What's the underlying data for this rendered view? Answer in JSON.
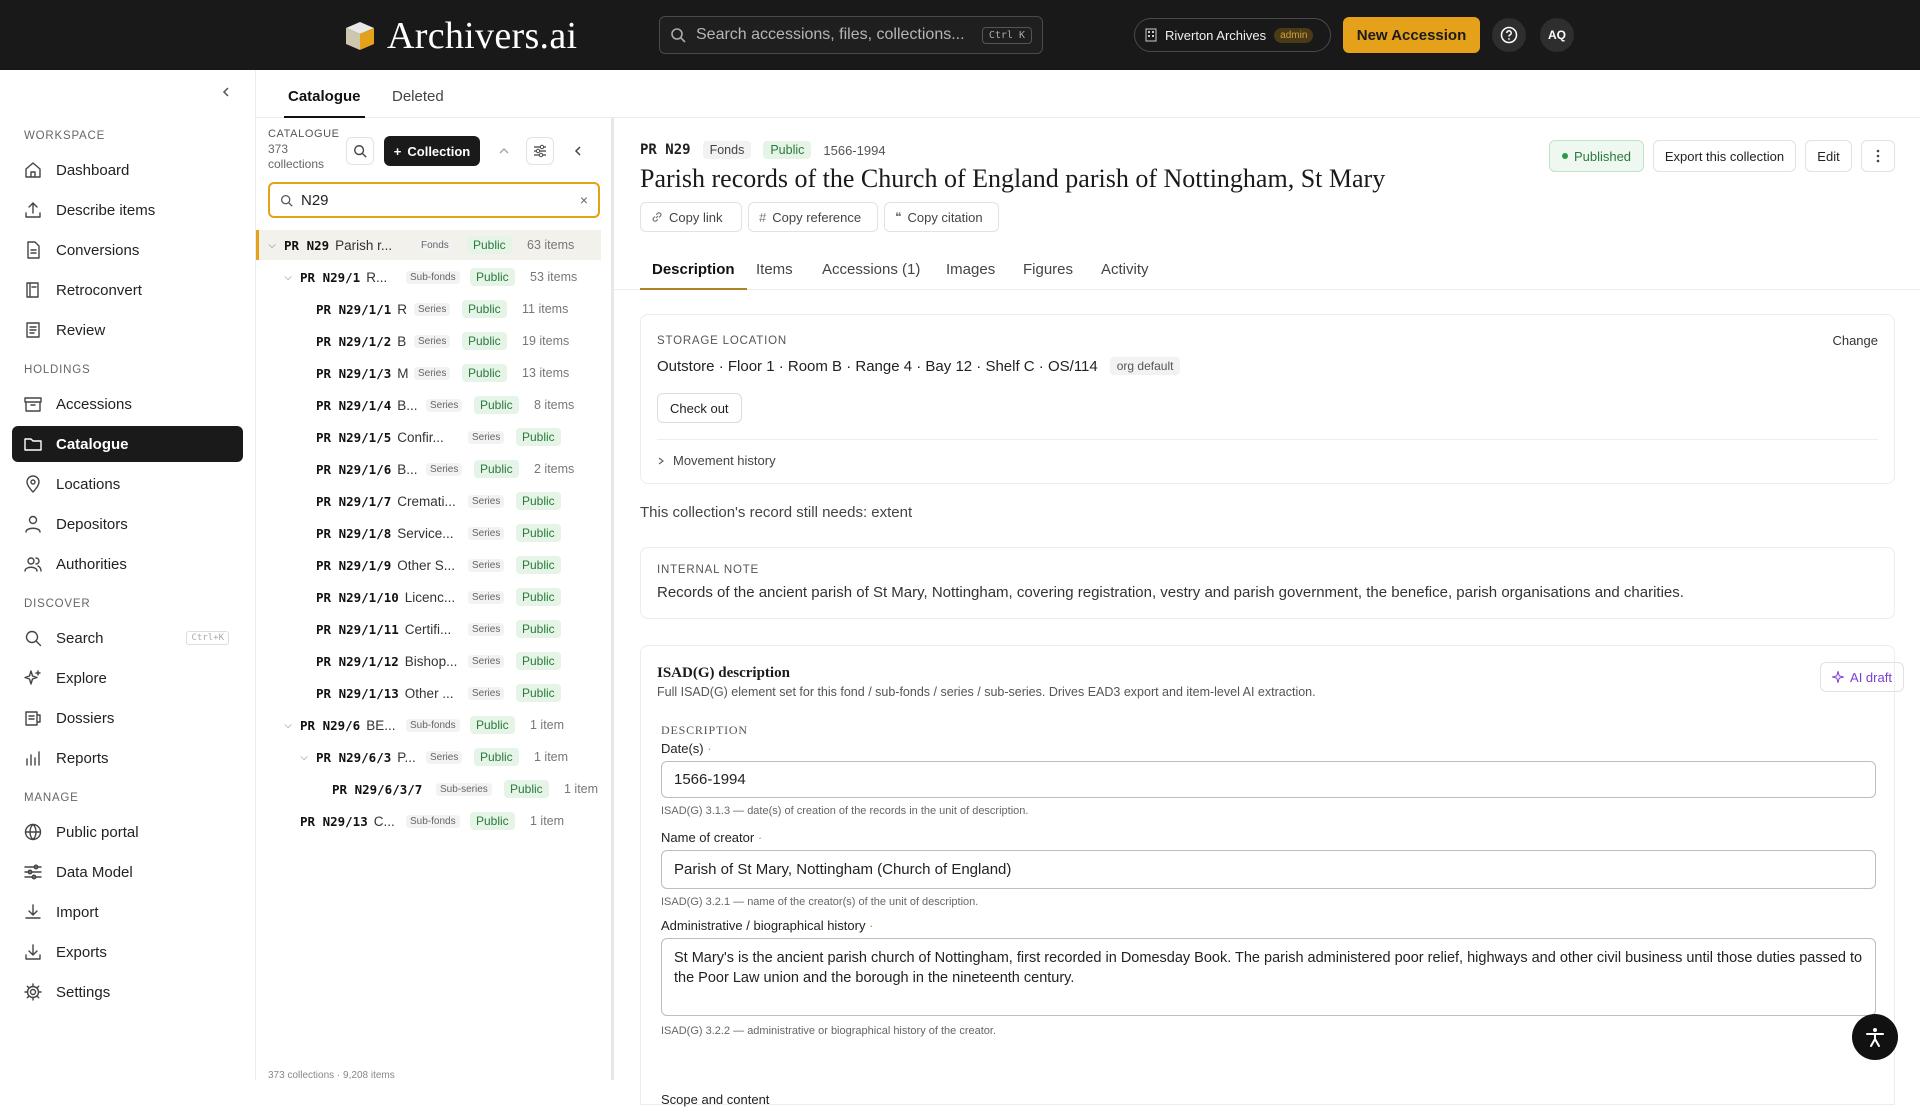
{
  "app": {
    "name": "Archivers.ai"
  },
  "topbar": {
    "search_placeholder": "Search accessions, files, collections...",
    "search_shortcut": "Ctrl K",
    "org_name": "Riverton Archives",
    "org_role": "admin",
    "new_button": "New Accession",
    "avatar": "AQ"
  },
  "sidebar": {
    "sections": [
      {
        "title": "WORKSPACE",
        "items": [
          {
            "label": "Dashboard",
            "icon": "home-icon"
          },
          {
            "label": "Describe items",
            "icon": "upload-icon"
          },
          {
            "label": "Conversions",
            "icon": "file-icon"
          },
          {
            "label": "Retroconvert",
            "icon": "book-icon"
          },
          {
            "label": "Review",
            "icon": "review-icon"
          }
        ]
      },
      {
        "title": "HOLDINGS",
        "items": [
          {
            "label": "Accessions",
            "icon": "archive-icon"
          },
          {
            "label": "Catalogue",
            "icon": "folder-icon",
            "active": true
          },
          {
            "label": "Locations",
            "icon": "pin-icon"
          },
          {
            "label": "Depositors",
            "icon": "user-icon"
          },
          {
            "label": "Authorities",
            "icon": "users-icon"
          }
        ]
      },
      {
        "title": "DISCOVER",
        "items": [
          {
            "label": "Search",
            "icon": "search-icon",
            "shortcut": "Ctrl+K"
          },
          {
            "label": "Explore",
            "icon": "sparkle-icon"
          },
          {
            "label": "Dossiers",
            "icon": "dossier-icon"
          },
          {
            "label": "Reports",
            "icon": "chart-icon"
          }
        ]
      },
      {
        "title": "MANAGE",
        "items": [
          {
            "label": "Public portal",
            "icon": "globe-icon"
          },
          {
            "label": "Data Model",
            "icon": "sliders-icon"
          },
          {
            "label": "Import",
            "icon": "download-icon"
          },
          {
            "label": "Exports",
            "icon": "export-icon"
          },
          {
            "label": "Settings",
            "icon": "gear-icon"
          }
        ]
      }
    ]
  },
  "tabs": {
    "catalogue": "Catalogue",
    "deleted": "Deleted"
  },
  "tree": {
    "heading": "CATALOGUE",
    "count": "373",
    "count_label": "collections",
    "add_button": "Collection",
    "filter_value": "N29",
    "footer": "373 collections · 9,208 items",
    "rows": [
      {
        "ref": "PR N29",
        "name": "Parish r...",
        "level": "Fonds",
        "status": "Public",
        "count": "63 items",
        "depth": 0,
        "expanded": true,
        "selected": true
      },
      {
        "ref": "PR N29/1",
        "name": "R...",
        "level": "Sub-fonds",
        "status": "Public",
        "count": "53 items",
        "depth": 1,
        "expanded": true
      },
      {
        "ref": "PR N29/1/1",
        "name": "R",
        "level": "Series",
        "status": "Public",
        "count": "11 items",
        "depth": 2
      },
      {
        "ref": "PR N29/1/2",
        "name": "B",
        "level": "Series",
        "status": "Public",
        "count": "19 items",
        "depth": 2
      },
      {
        "ref": "PR N29/1/3",
        "name": "M",
        "level": "Series",
        "status": "Public",
        "count": "13 items",
        "depth": 2
      },
      {
        "ref": "PR N29/1/4",
        "name": "B...",
        "level": "Series",
        "status": "Public",
        "count": "8 items",
        "depth": 2
      },
      {
        "ref": "PR N29/1/5",
        "name": "Confir...",
        "level": "Series",
        "status": "Public",
        "count": "",
        "depth": 2
      },
      {
        "ref": "PR N29/1/6",
        "name": "B...",
        "level": "Series",
        "status": "Public",
        "count": "2 items",
        "depth": 2
      },
      {
        "ref": "PR N29/1/7",
        "name": "Cremati...",
        "level": "Series",
        "status": "Public",
        "count": "",
        "depth": 2
      },
      {
        "ref": "PR N29/1/8",
        "name": "Service...",
        "level": "Series",
        "status": "Public",
        "count": "",
        "depth": 2
      },
      {
        "ref": "PR N29/1/9",
        "name": "Other S...",
        "level": "Series",
        "status": "Public",
        "count": "",
        "depth": 2
      },
      {
        "ref": "PR N29/1/10",
        "name": "Licenc...",
        "level": "Series",
        "status": "Public",
        "count": "",
        "depth": 2
      },
      {
        "ref": "PR N29/1/11",
        "name": "Certifi...",
        "level": "Series",
        "status": "Public",
        "count": "",
        "depth": 2
      },
      {
        "ref": "PR N29/1/12",
        "name": "Bishop...",
        "level": "Series",
        "status": "Public",
        "count": "",
        "depth": 2
      },
      {
        "ref": "PR N29/1/13",
        "name": "Other ...",
        "level": "Series",
        "status": "Public",
        "count": "",
        "depth": 2
      },
      {
        "ref": "PR N29/6",
        "name": "BE...",
        "level": "Sub-fonds",
        "status": "Public",
        "count": "1 item",
        "depth": 1,
        "expanded": true
      },
      {
        "ref": "PR N29/6/3",
        "name": "P...",
        "level": "Series",
        "status": "Public",
        "count": "1 item",
        "depth": 2,
        "expanded": true
      },
      {
        "ref": "PR N29/6/3/7",
        "name": "",
        "level": "Sub-series",
        "status": "Public",
        "count": "1 item",
        "depth": 3
      },
      {
        "ref": "PR N29/13",
        "name": "C...",
        "level": "Sub-fonds",
        "status": "Public",
        "count": "1 item",
        "depth": 1
      }
    ]
  },
  "record": {
    "ref": "PR N29",
    "level": "Fonds",
    "status": "Public",
    "dates": "1566-1994",
    "title": "Parish records of the Church of England parish of Nottingham, St Mary",
    "actions": {
      "copy_link": "Copy link",
      "copy_reference": "Copy reference",
      "copy_citation": "Copy citation"
    },
    "state": "Published",
    "export_button": "Export this collection",
    "edit_button": "Edit",
    "tabs": [
      "Description",
      "Items",
      "Accessions (1)",
      "Images",
      "Figures",
      "Activity"
    ]
  },
  "storage": {
    "label": "STORAGE LOCATION",
    "change": "Change",
    "location": "Outstore · Floor 1 · Room B · Range 4 · Bay 12 · Shelf C · OS/114",
    "badge": "org default",
    "checkout": "Check out",
    "history": "Movement history"
  },
  "needs": "This collection's record still needs: extent",
  "note": {
    "label": "INTERNAL NOTE",
    "text": "Records of the ancient parish of St Mary, Nottingham, covering registration, vestry and parish government, the benefice, parish organisations and charities."
  },
  "isad": {
    "title": "ISAD(G) description",
    "subtitle": "Full ISAD(G) element set for this fond / sub-fonds / series / sub-series. Drives EAD3 export and item-level AI extraction.",
    "ai_button": "AI draft",
    "section": "DESCRIPTION",
    "fields": {
      "dates": {
        "label": "Date(s)",
        "value": "1566-1994",
        "hint": "ISAD(G) 3.1.3 — date(s) of creation of the records in the unit of description."
      },
      "creator": {
        "label": "Name of creator",
        "value": "Parish of St Mary, Nottingham (Church of England)",
        "hint": "ISAD(G) 3.2.1 — name of the creator(s) of the unit of description."
      },
      "history": {
        "label": "Administrative / biographical history",
        "value": "St Mary's is the ancient parish church of Nottingham, first recorded in Domesday Book. The parish administered poor relief, highways and other civil business until those duties passed to the Poor Law union and the borough in the nineteenth century.",
        "hint": "ISAD(G) 3.2.2 — administrative or biographical history of the creator."
      },
      "scope": {
        "label": "Scope and content"
      }
    }
  }
}
